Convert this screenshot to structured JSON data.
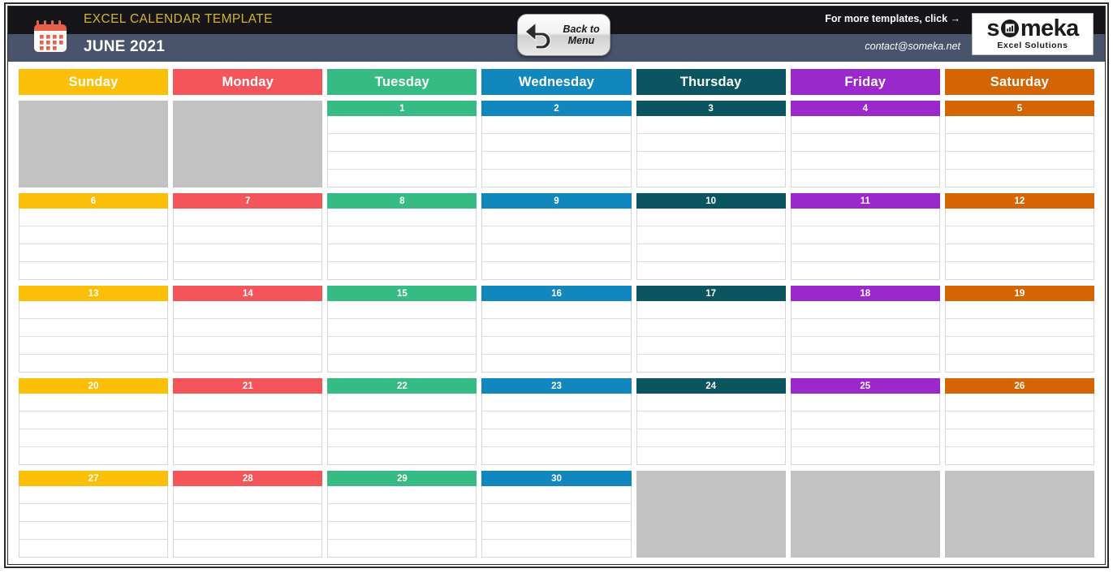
{
  "header": {
    "template_title": "EXCEL CALENDAR TEMPLATE",
    "month_title": "JUNE 2021",
    "calendar_icon": "calendar-icon",
    "back_button": {
      "line1": "Back to",
      "line2": "Menu",
      "icon": "back-arrow-icon"
    },
    "more_templates": "For more templates, click →",
    "contact_email": "contact@someka.net",
    "logo": {
      "word_part1": "s",
      "word_part2": "meka",
      "subtitle": "Excel Solutions",
      "mark_icon": "chart-in-circle-icon"
    },
    "colors": {
      "band_top": "#16161a",
      "band_bottom": "#49536b",
      "template_title": "#d8b22a"
    }
  },
  "calendar": {
    "day_headers": [
      {
        "label": "Sunday",
        "color": "#fcbf08"
      },
      {
        "label": "Monday",
        "color": "#f4555a"
      },
      {
        "label": "Tuesday",
        "color": "#36bb84"
      },
      {
        "label": "Wednesday",
        "color": "#1287bd"
      },
      {
        "label": "Thursday",
        "color": "#0a5560"
      },
      {
        "label": "Friday",
        "color": "#9b28ca"
      },
      {
        "label": "Saturday",
        "color": "#d56405"
      }
    ],
    "empty_cell_color": "#c2c2c2",
    "weeks": [
      [
        null,
        null,
        "1",
        "2",
        "3",
        "4",
        "5"
      ],
      [
        "6",
        "7",
        "8",
        "9",
        "10",
        "11",
        "12"
      ],
      [
        "13",
        "14",
        "15",
        "16",
        "17",
        "18",
        "19"
      ],
      [
        "20",
        "21",
        "22",
        "23",
        "24",
        "25",
        "26"
      ],
      [
        "27",
        "28",
        "29",
        "30",
        null,
        null,
        null
      ]
    ],
    "lines_per_cell": 4
  }
}
